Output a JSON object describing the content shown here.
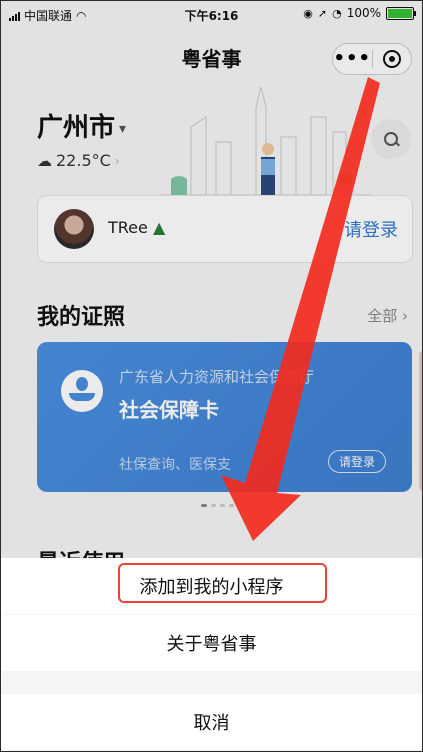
{
  "status_bar": {
    "carrier": "中国联通",
    "time": "下午6:16",
    "battery": "100%"
  },
  "nav": {
    "title": "粤省事",
    "more_icon": "more-dots-icon",
    "close_icon": "target-icon"
  },
  "header": {
    "city": "广州市",
    "temperature": "22.5°C"
  },
  "user": {
    "name": "TRee",
    "login": "请登录"
  },
  "certificates": {
    "title": "我的证照",
    "all": "全部",
    "card": {
      "department": "广东省人力资源和社会保障厅",
      "name": "社会保障卡",
      "subtitle": "社保查询、医保支",
      "login": "请登录"
    }
  },
  "recent_title": "最近使用",
  "action_sheet": {
    "items": [
      "添加到我的小程序",
      "关于粤省事"
    ],
    "cancel": "取消"
  },
  "colors": {
    "accent": "#2f78d8",
    "card": "#4a90e2",
    "highlight": "#e8433a",
    "arrow": "#f22a1e"
  }
}
